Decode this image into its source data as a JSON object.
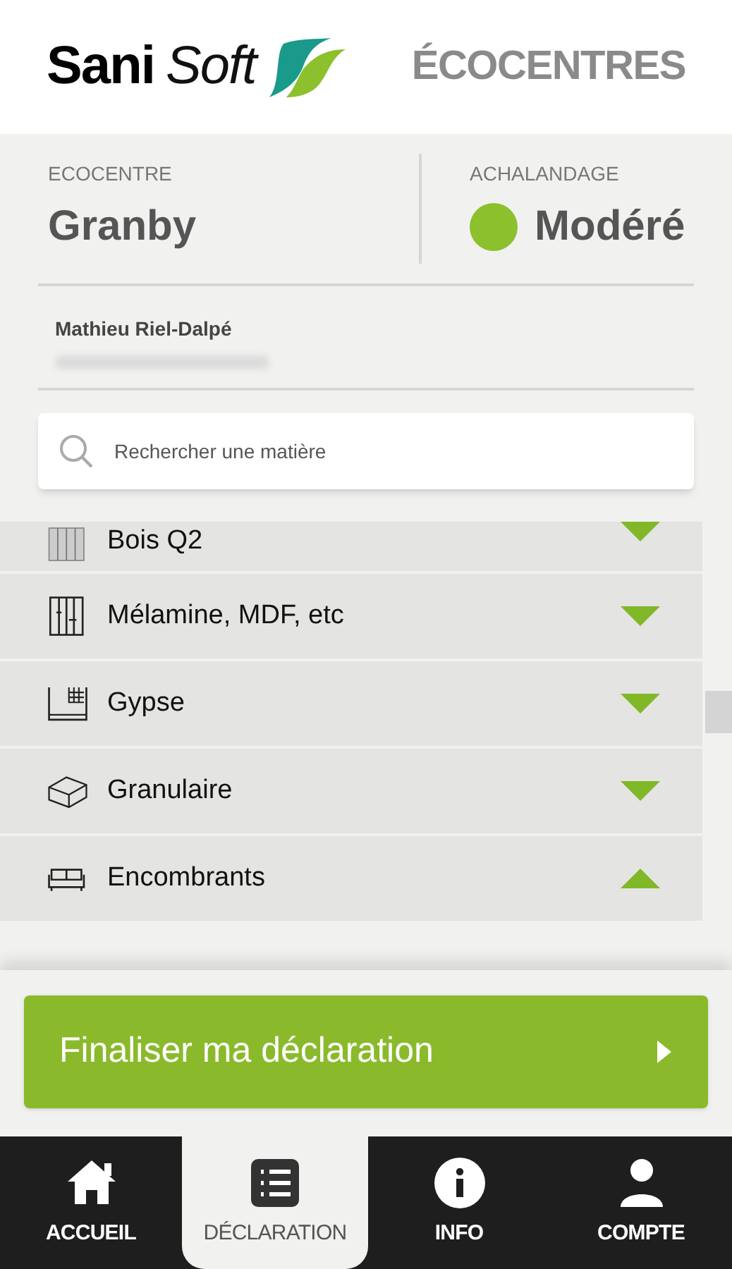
{
  "header": {
    "logo_bold": "Sani",
    "logo_light": "Soft",
    "title": "ÉCOCENTRES"
  },
  "ecocentre": {
    "label": "ECOCENTRE",
    "value": "Granby"
  },
  "achalandage": {
    "label": "ACHALANDAGE",
    "value": "Modéré",
    "color": "#8cc02c"
  },
  "user": {
    "name": "Mathieu Riel-Dalpé"
  },
  "search": {
    "placeholder": "Rechercher une matière"
  },
  "categories": [
    {
      "label": "Bois Q2",
      "kind": "wood",
      "expanded": false
    },
    {
      "label": "Mélamine, MDF, etc",
      "kind": "panels",
      "expanded": false
    },
    {
      "label": "Gypse",
      "kind": "drywall",
      "expanded": false
    },
    {
      "label": "Granulaire",
      "kind": "brick",
      "expanded": false
    },
    {
      "label": "Encombrants",
      "kind": "sofa",
      "expanded": true
    }
  ],
  "finalize_button": {
    "label": "Finaliser ma déclaration"
  },
  "nav": [
    {
      "label": "ACCUEIL",
      "kind": "home",
      "selected": false
    },
    {
      "label": "DÉCLARATION",
      "kind": "list",
      "selected": true
    },
    {
      "label": "INFO",
      "kind": "info",
      "selected": false
    },
    {
      "label": "COMPTE",
      "kind": "user",
      "selected": false
    }
  ]
}
